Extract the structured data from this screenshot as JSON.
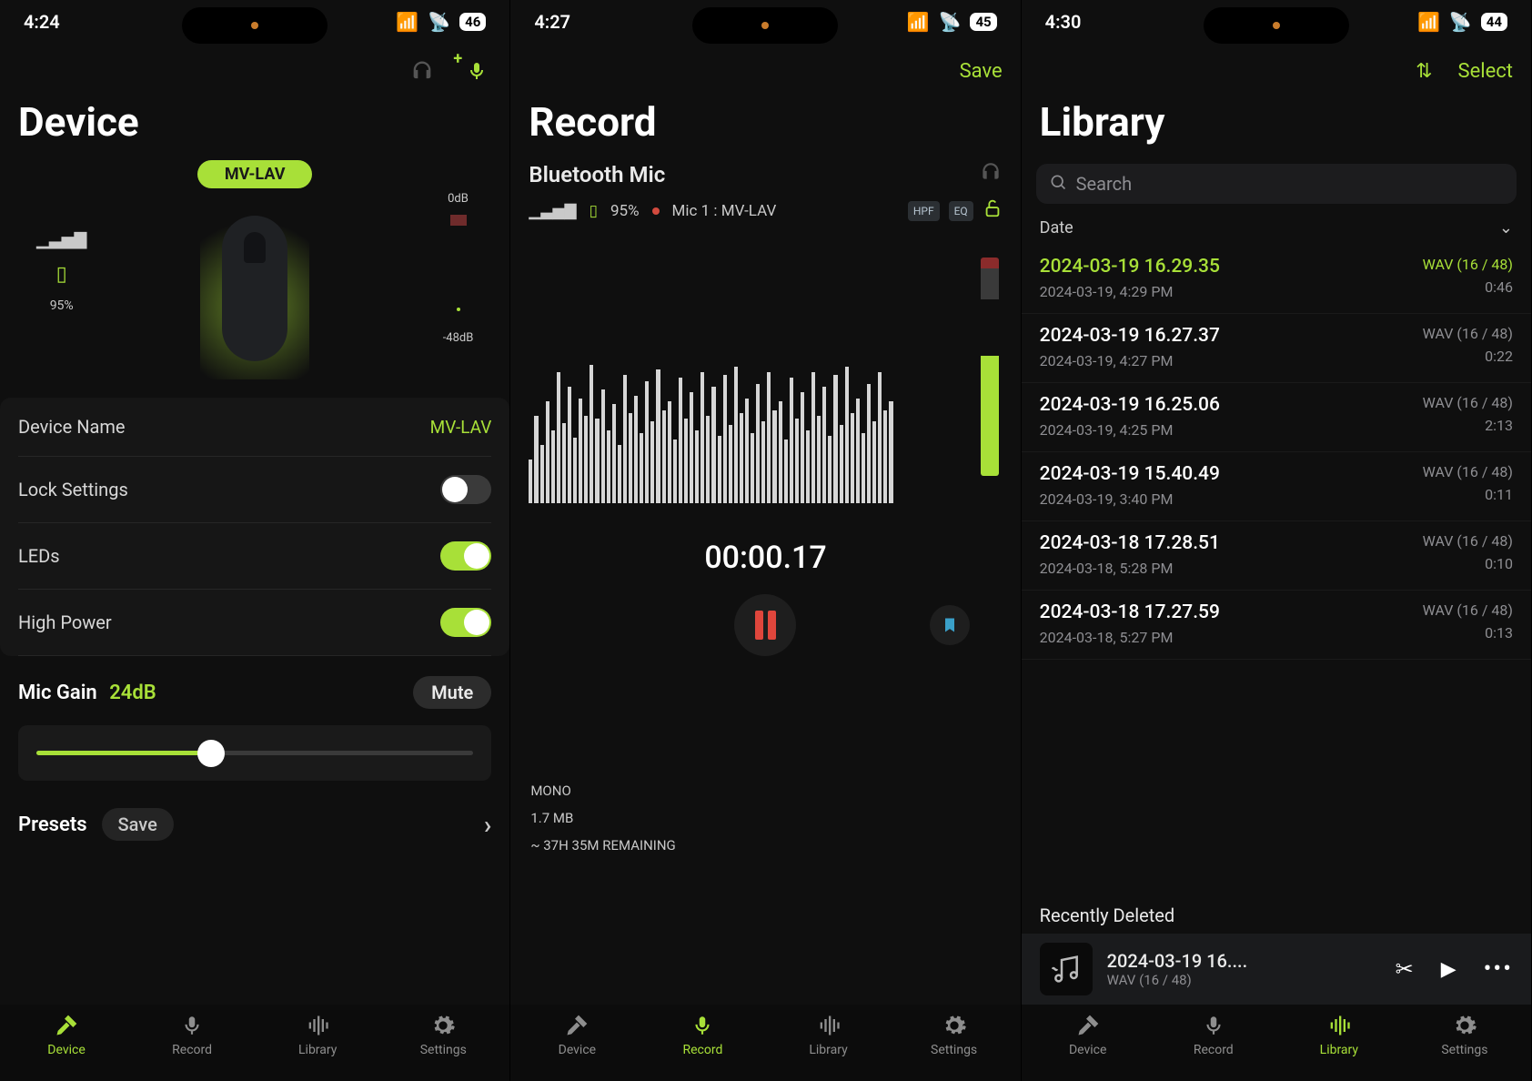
{
  "screens": {
    "device": {
      "status": {
        "time": "4:24",
        "battery": "46"
      },
      "title": "Device",
      "badge": "MV-LAV",
      "signal_battery_pct": "95%",
      "db_top": "0dB",
      "db_bottom": "-48dB",
      "settings": {
        "device_name_label": "Device Name",
        "device_name_value": "MV-LAV",
        "lock_label": "Lock Settings",
        "lock_on": false,
        "leds_label": "LEDs",
        "leds_on": true,
        "hp_label": "High Power",
        "hp_on": true
      },
      "gain": {
        "label": "Mic Gain",
        "value": "24dB",
        "mute": "Mute"
      },
      "presets": {
        "label": "Presets",
        "save": "Save"
      },
      "tabs": {
        "active": "Device",
        "items": [
          "Device",
          "Record",
          "Library",
          "Settings"
        ]
      }
    },
    "record": {
      "status": {
        "time": "4:27",
        "battery": "45"
      },
      "save": "Save",
      "title": "Record",
      "source": "Bluetooth Mic",
      "battery_pct": "95%",
      "mic_label": "Mic 1 : MV-LAV",
      "chips": {
        "hpf": "HPF",
        "eq": "EQ"
      },
      "timer": "00:00.17",
      "info": {
        "channels": "MONO",
        "size": "1.7 MB",
        "remaining": "~ 37H 35M REMAINING"
      },
      "tabs": {
        "active": "Record",
        "items": [
          "Device",
          "Record",
          "Library",
          "Settings"
        ]
      }
    },
    "library": {
      "status": {
        "time": "4:30",
        "battery": "44"
      },
      "select": "Select",
      "title": "Library",
      "search_placeholder": "Search",
      "section": "Date",
      "items": [
        {
          "title": "2024-03-19 16.29.35",
          "subtitle": "2024-03-19, 4:29 PM",
          "format": "WAV (16 / 48)",
          "dur": "0:46",
          "active": true
        },
        {
          "title": "2024-03-19 16.27.37",
          "subtitle": "2024-03-19, 4:27 PM",
          "format": "WAV (16 / 48)",
          "dur": "0:22",
          "active": false
        },
        {
          "title": "2024-03-19 16.25.06",
          "subtitle": "2024-03-19, 4:25 PM",
          "format": "WAV (16 / 48)",
          "dur": "2:13",
          "active": false
        },
        {
          "title": "2024-03-19 15.40.49",
          "subtitle": "2024-03-19, 3:40 PM",
          "format": "WAV (16 / 48)",
          "dur": "0:11",
          "active": false
        },
        {
          "title": "2024-03-18 17.28.51",
          "subtitle": "2024-03-18, 5:28 PM",
          "format": "WAV (16 / 48)",
          "dur": "0:10",
          "active": false
        },
        {
          "title": "2024-03-18 17.27.59",
          "subtitle": "2024-03-18, 5:27 PM",
          "format": "WAV (16 / 48)",
          "dur": "0:13",
          "active": false
        }
      ],
      "recently_deleted": "Recently Deleted",
      "now_playing": {
        "title": "2024-03-19 16....",
        "sub": "WAV (16 / 48)"
      },
      "tabs": {
        "active": "Library",
        "items": [
          "Device",
          "Record",
          "Library",
          "Settings"
        ]
      }
    }
  },
  "icons": {
    "signal": "▮",
    "wifi": "􀙇",
    "headphones": "🎧",
    "mic": "🎙",
    "tools": "🛠",
    "equalizer": "⦀",
    "gear": "⚙",
    "sort": "⇅",
    "search": "🔍",
    "chevron_right": "›",
    "chevron_down": "⌄",
    "bookmark": "🔖",
    "scissors": "✂",
    "play": "▶",
    "more": "⋯",
    "battery": "▮",
    "art": "𝅘𝅥𝅮"
  }
}
